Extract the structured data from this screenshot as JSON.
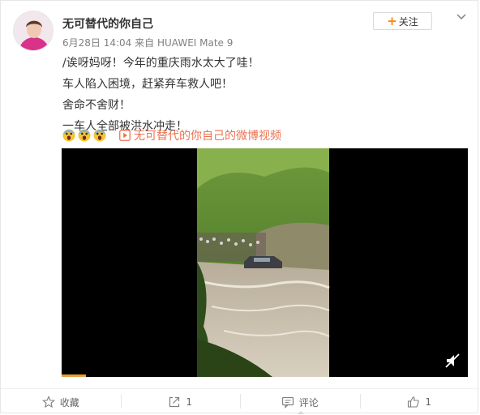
{
  "post": {
    "username": "无可替代的你自己",
    "date": "6月28日 14:04",
    "source_prefix": "来自",
    "source_device": "HUAWEI Mate 9",
    "follow_label": "关注",
    "lines": [
      "/诶呀妈呀！今年的重庆雨水太大了哇！",
      "车人陷入困境，赶紧弃车救人吧！",
      "舍命不舍财！",
      "一车人全部被洪水冲走！"
    ],
    "emojis": [
      "shocked-face-icon",
      "shocked-face-icon",
      "shocked-face-icon"
    ],
    "video_link": "无可替代的你自己的微博视频",
    "video_progress": 0.06
  },
  "actions": {
    "favorite": "收藏",
    "repost_count": "1",
    "comment": "评论",
    "like_count": "1"
  },
  "colors": {
    "accent_orange": "#ff8200",
    "link": "#eb7350",
    "progress": "#e5a03b"
  }
}
